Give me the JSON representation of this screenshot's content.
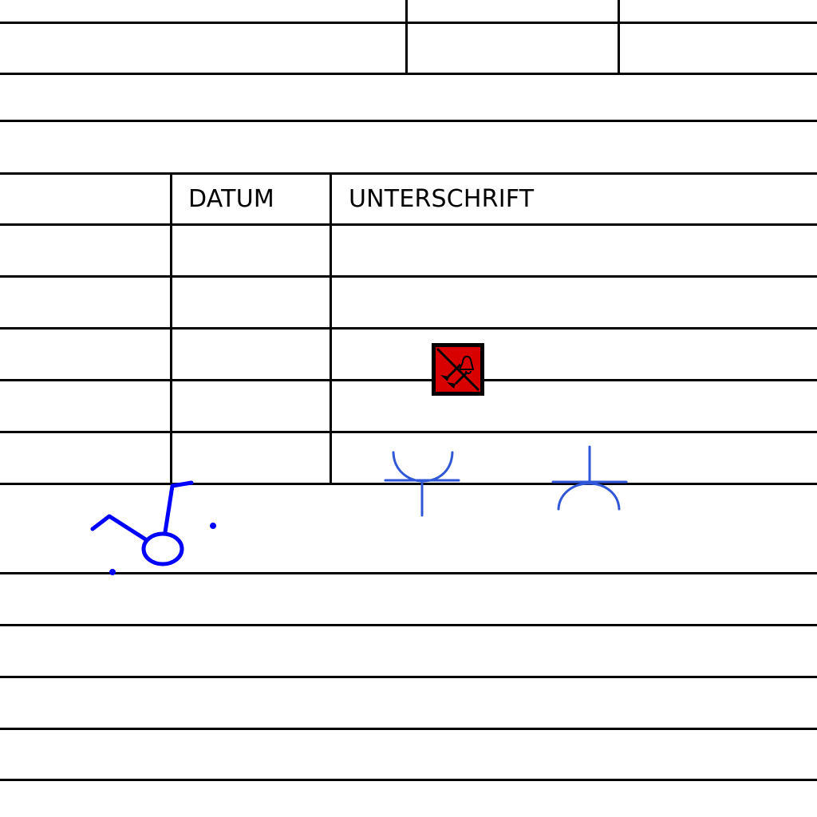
{
  "form": {
    "headers": {
      "date": "DATUM",
      "signature": "UNTERSCHRIFT"
    }
  },
  "icons": {
    "status_icon": "crossed-out-bell-alarm-icon"
  },
  "colors": {
    "ink": "#0000ff",
    "rules": "#000000",
    "status_icon_background": "#d90000"
  }
}
